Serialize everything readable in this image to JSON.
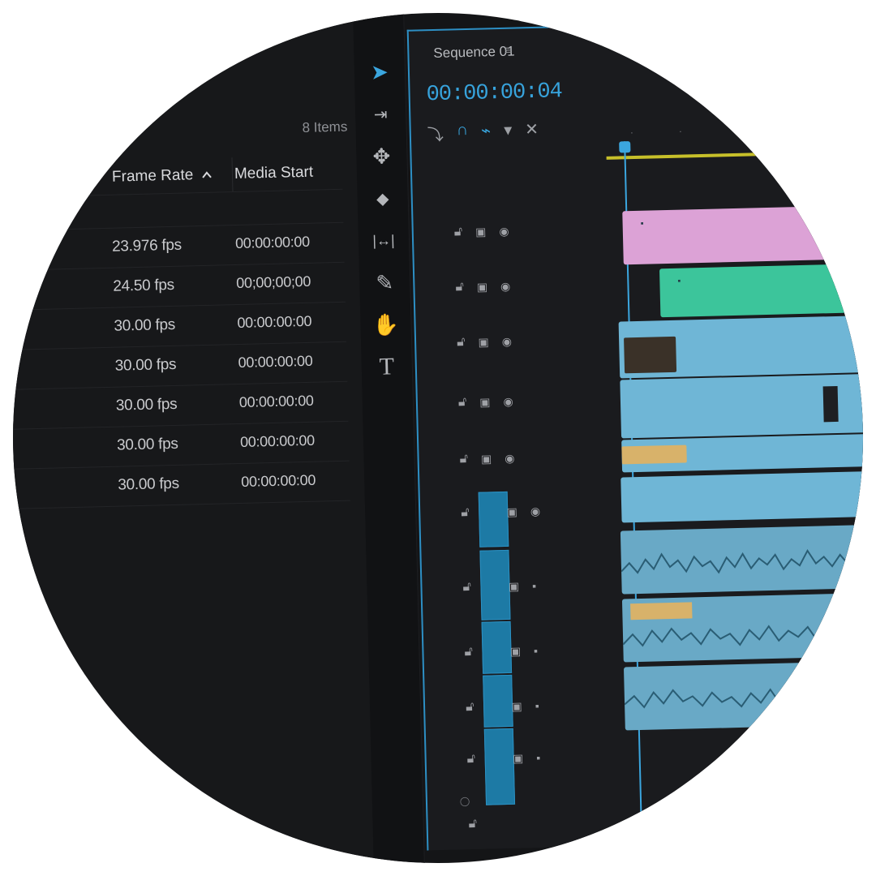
{
  "project_panel": {
    "item_count": "8 Items",
    "columns": {
      "frame_rate": "Frame Rate",
      "media_start": "Media Start"
    },
    "rows": [
      {
        "frame_rate": "",
        "media_start": ""
      },
      {
        "frame_rate": "23.976 fps",
        "media_start": "00:00:00:00"
      },
      {
        "frame_rate": "24.50 fps",
        "media_start": "00;00;00;00"
      },
      {
        "frame_rate": "30.00 fps",
        "media_start": "00:00:00:00"
      },
      {
        "frame_rate": "30.00 fps",
        "media_start": "00:00:00:00"
      },
      {
        "frame_rate": "30.00 fps",
        "media_start": "00:00:00:00"
      },
      {
        "frame_rate": "30.00 fps",
        "media_start": "00:00:00:00"
      },
      {
        "frame_rate": "30.00 fps",
        "media_start": "00:00:00:00"
      }
    ]
  },
  "tools": [
    {
      "icon": "selection-arrow-icon",
      "glyph": "➤"
    },
    {
      "icon": "track-select-icon",
      "glyph": "⇥"
    },
    {
      "icon": "ripple-edit-icon",
      "glyph": "✥"
    },
    {
      "icon": "razor-icon",
      "glyph": "◆"
    },
    {
      "icon": "slip-icon",
      "glyph": "|↔|"
    },
    {
      "icon": "pen-icon",
      "glyph": "✎"
    },
    {
      "icon": "hand-icon",
      "glyph": "✋"
    },
    {
      "icon": "type-icon",
      "glyph": "T"
    }
  ],
  "timeline": {
    "sequence_tab": "Sequence 01",
    "menu_glyph": "≡",
    "timecode": "00:00:00:04",
    "icons": [
      "nest-icon",
      "snap-icon",
      "linked-selection-icon",
      "marker-icon",
      "settings-icon"
    ],
    "colors": {
      "accent": "#37a3dc",
      "pink_clip": "#dca2d6",
      "green_clip": "#3cc59b",
      "video_clip": "#6fb6d6",
      "audio_clip": "#69a9c6",
      "work_area": "#c7c02a"
    }
  }
}
